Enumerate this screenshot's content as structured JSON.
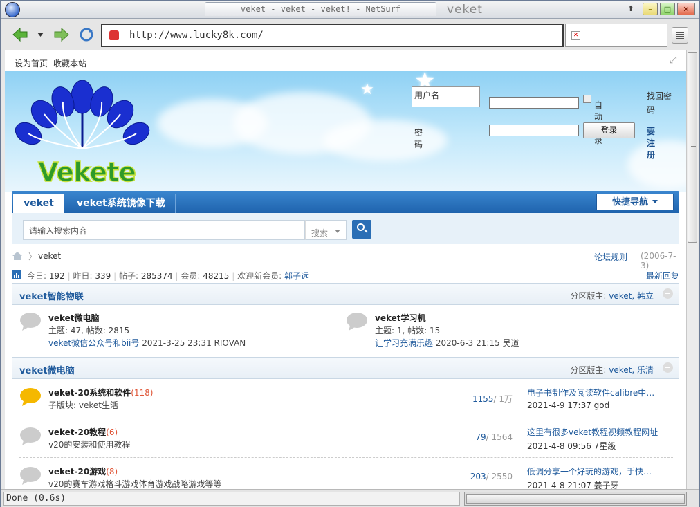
{
  "window": {
    "title": "veket - veket - veket! - NetSurf",
    "title_right": "veket"
  },
  "browser": {
    "url": "http://www.lucky8k.com/",
    "status": "Done (0.6s)"
  },
  "topbar": {
    "set_home": "设为首页",
    "bookmark": "收藏本站"
  },
  "login": {
    "username_placeholder": "用户名",
    "password_label": "密码",
    "auto_login": "自动登录",
    "login_button": "登录",
    "find_password": "找回密码",
    "register": "要注册"
  },
  "logo": {
    "text": "Vekete"
  },
  "nav": {
    "tab_active": "veket",
    "tab_mirror": "veket系统镜像下载",
    "quick_nav": "快捷导航"
  },
  "search": {
    "placeholder": "请输入搜索内容",
    "type": "搜索"
  },
  "breadcrumb": {
    "current": "veket",
    "rules": "论坛规则",
    "date": "(2006-7-3)"
  },
  "stats": {
    "today_label": "今日:",
    "today": "192",
    "yesterday_label": "昨日:",
    "yesterday": "339",
    "posts_label": "帖子:",
    "posts": "285374",
    "members_label": "会员:",
    "members": "48215",
    "welcome_label": "欢迎新会员:",
    "new_member": "郭子远",
    "latest_replies": "最新回复"
  },
  "sections": [
    {
      "name": "veket智能物联",
      "mods_label": "分区版主:",
      "mods": "veket, 韩立",
      "forums": [
        {
          "name": "veket微电脑",
          "meta": "主题: 47, 帖数: 2815",
          "last_title": "veket微信公众号和bii号",
          "last_info": "2021-3-25 23:31 RIOVAN"
        },
        {
          "name": "veket学习机",
          "meta": "主题: 1, 帖数: 15",
          "last_title": "让学习充满乐趣",
          "last_info": "2020-6-3 21:15 吴道"
        }
      ]
    },
    {
      "name": "veket微电脑",
      "mods_label": "分区版主:",
      "mods": "veket, 乐清",
      "forums": [
        {
          "name": "veket-20系统和软件",
          "new_count": "(118)",
          "sub": "子版块: veket生活",
          "threads": "1155",
          "posts": "/ 1万",
          "last_title": "电子书制作及阅读软件calibre中文版",
          "last_info": "2021-4-9 17:37 god"
        },
        {
          "name": "veket-20教程",
          "new_count": "(6)",
          "sub": "v20的安装和使用教程",
          "threads": "79",
          "posts": "/ 1564",
          "last_title": "这里有很多veket教程视频教程网址",
          "last_info": "2021-4-8 09:56 7星级"
        },
        {
          "name": "veket-20游戏",
          "new_count": "(8)",
          "sub": "v20的赛车游戏格斗游戏体育游戏战略游戏等等",
          "threads": "203",
          "posts": "/ 2550",
          "last_title": "低调分享一个好玩的游戏，手快有手慢无",
          "last_info": "2021-4-8 21:07 姜子牙"
        }
      ]
    }
  ],
  "colors": {
    "link": "#1f5a9c",
    "nav": "#2a6eb5",
    "new_count": "#e0583a"
  }
}
